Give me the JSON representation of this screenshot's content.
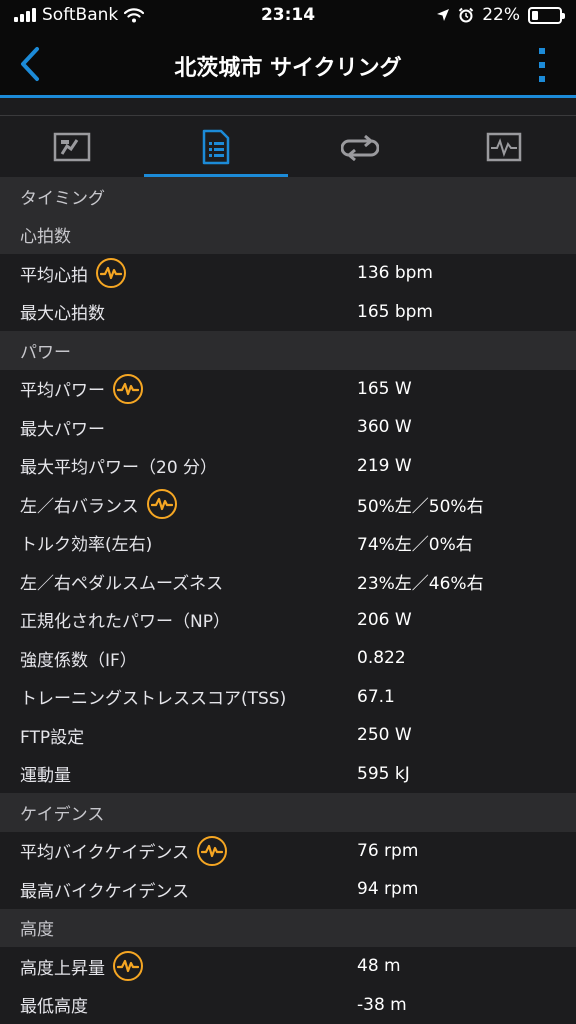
{
  "status_bar": {
    "carrier": "SoftBank",
    "time": "23:14",
    "battery": "22%",
    "battery_level": 0.22
  },
  "nav": {
    "title": "北茨城市 サイクリング",
    "accent_color": "#1c8bd8"
  },
  "tabs": [
    {
      "icon": "map-icon",
      "active": false
    },
    {
      "icon": "stats-list-icon",
      "active": true
    },
    {
      "icon": "laps-loop-icon",
      "active": false
    },
    {
      "icon": "chart-graph-icon",
      "active": false
    }
  ],
  "badge_color": "#f5a623",
  "sections": [
    {
      "title": "タイミング",
      "rows": []
    },
    {
      "title": "心拍数",
      "rows": [
        {
          "label": "平均心拍",
          "value": "136 bpm",
          "chart": true
        },
        {
          "label": "最大心拍数",
          "value": "165 bpm",
          "chart": false
        }
      ]
    },
    {
      "title": "パワー",
      "rows": [
        {
          "label": "平均パワー",
          "value": "165 W",
          "chart": true
        },
        {
          "label": "最大パワー",
          "value": "360 W",
          "chart": false
        },
        {
          "label": "最大平均パワー（20 分）",
          "value": "219 W",
          "chart": false
        },
        {
          "label": "左／右バランス",
          "value": "50%左／50%右",
          "chart": true
        },
        {
          "label": "トルク効率(左右)",
          "value": "74%左／0%右",
          "chart": false
        },
        {
          "label": "左／右ペダルスムーズネス",
          "value": "23%左／46%右",
          "chart": false
        },
        {
          "label": "正規化されたパワー（NP）",
          "value": "206 W",
          "chart": false
        },
        {
          "label": "強度係数（IF）",
          "value": "0.822",
          "chart": false
        },
        {
          "label": "トレーニングストレススコア(TSS)",
          "value": "67.1",
          "chart": false
        },
        {
          "label": "FTP設定",
          "value": "250 W",
          "chart": false
        },
        {
          "label": "運動量",
          "value": "595 kJ",
          "chart": false
        }
      ]
    },
    {
      "title": "ケイデンス",
      "rows": [
        {
          "label": "平均バイクケイデンス",
          "value": "76 rpm",
          "chart": true
        },
        {
          "label": "最高バイクケイデンス",
          "value": "94 rpm",
          "chart": false
        }
      ]
    },
    {
      "title": "高度",
      "rows": [
        {
          "label": "高度上昇量",
          "value": "48 m",
          "chart": true
        },
        {
          "label": "最低高度",
          "value": "-38 m",
          "chart": false
        }
      ]
    }
  ]
}
